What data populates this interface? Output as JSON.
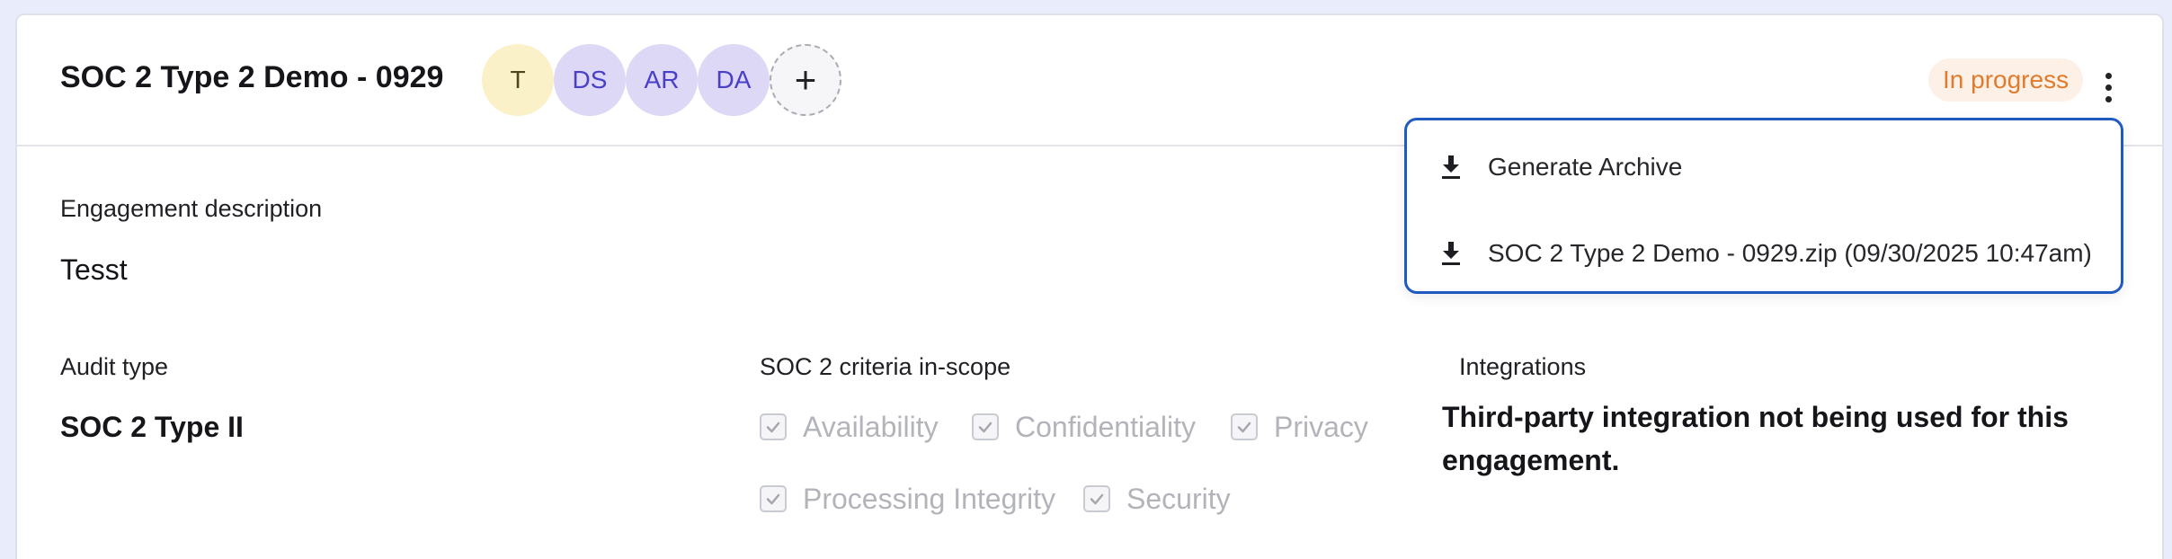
{
  "engagement": {
    "title": "SOC 2 Type 2 Demo - 0929",
    "status": "In progress",
    "colors": {
      "status_text": "#e07b2c",
      "status_bg": "#fdf0e6",
      "menu_border": "#1f5bbf"
    }
  },
  "members": [
    {
      "initials": "T",
      "bg": "#fbf1c9",
      "fg": "#4d4420"
    },
    {
      "initials": "DS",
      "bg": "#dcd8f6",
      "fg": "#4a3fc9"
    },
    {
      "initials": "AR",
      "bg": "#dcd8f6",
      "fg": "#4a3fc9"
    },
    {
      "initials": "DA",
      "bg": "#dcd8f6",
      "fg": "#4a3fc9"
    }
  ],
  "add_member_label": "+",
  "description": {
    "label": "Engagement description",
    "value": "Tesst"
  },
  "audit_type": {
    "label": "Audit type",
    "value": "SOC 2 Type II"
  },
  "criteria": {
    "label": "SOC 2 criteria in-scope",
    "items": [
      {
        "label": "Availability",
        "checked": true
      },
      {
        "label": "Confidentiality",
        "checked": true
      },
      {
        "label": "Privacy",
        "checked": true
      },
      {
        "label": "Processing Integrity",
        "checked": true
      },
      {
        "label": "Security",
        "checked": true
      }
    ]
  },
  "integrations": {
    "label": "Integrations",
    "value": "Third-party integration not being used for this engagement."
  },
  "archive_menu": {
    "items": [
      {
        "label": "Generate Archive",
        "icon": "download-icon"
      },
      {
        "label": "SOC 2 Type 2 Demo - 0929.zip (09/30/2025 10:47am)",
        "icon": "download-icon"
      }
    ]
  }
}
